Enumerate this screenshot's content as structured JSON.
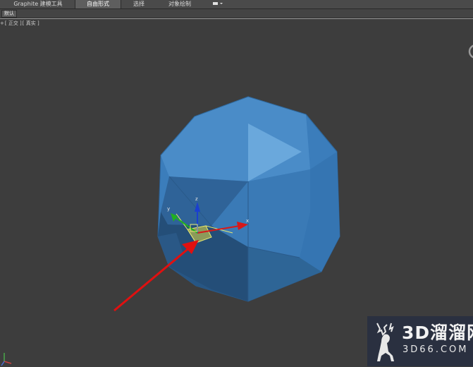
{
  "ribbon": {
    "tabs": [
      {
        "label": "Graphite 建模工具",
        "active": false
      },
      {
        "label": "自由形式",
        "active": true
      },
      {
        "label": "选择",
        "active": false
      },
      {
        "label": "对象绘制",
        "active": false
      }
    ],
    "panel_label": "默认"
  },
  "viewport": {
    "label_plus": "+",
    "label_view": "[ 正交 ]",
    "label_shading": "[ 真实 ]"
  },
  "gizmo": {
    "x_label": "x",
    "y_label": "y",
    "z_label": "z"
  },
  "colors": {
    "object": "#3f82be",
    "arrow": "#e01010",
    "gizmo_x": "#d81818",
    "gizmo_y": "#20b020",
    "gizmo_z": "#1a3fd0"
  },
  "watermark": {
    "title": "3D溜溜网",
    "subtitle": "3D66.COM"
  }
}
